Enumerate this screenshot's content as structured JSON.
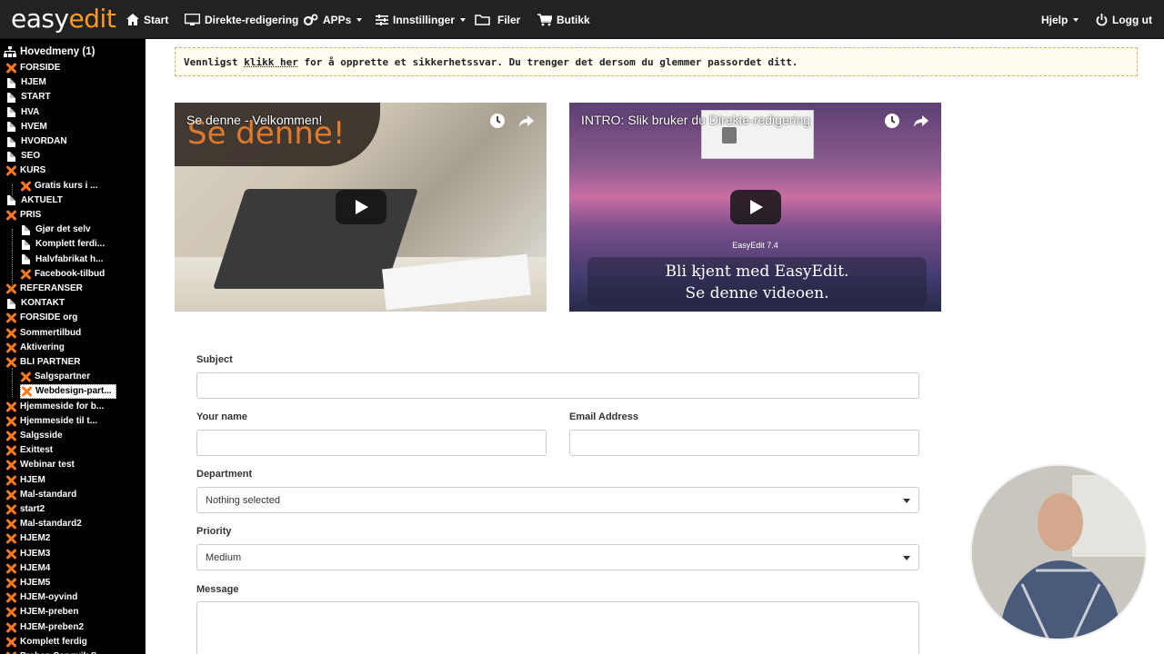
{
  "header": {
    "logo_part1": "easy",
    "logo_part2": "edit",
    "nav": [
      {
        "label": "Start",
        "icon": "home-icon"
      },
      {
        "label": "Direkte-redigering",
        "icon": "monitor-icon"
      },
      {
        "label": "APPs",
        "icon": "gears-icon",
        "dropdown": true
      },
      {
        "label": "Innstillinger",
        "icon": "sliders-icon",
        "dropdown": true
      },
      {
        "label": "Filer",
        "icon": "folder-icon"
      },
      {
        "label": "Butikk",
        "icon": "cart-icon"
      }
    ],
    "help_label": "Hjelp",
    "logout_label": "Logg ut"
  },
  "sidebar": {
    "root_label": "Hovedmeny (1)",
    "items": [
      {
        "label": "FORSIDE",
        "icon": "x",
        "level": 0
      },
      {
        "label": "HJEM",
        "icon": "page",
        "level": 0
      },
      {
        "label": "START",
        "icon": "page",
        "level": 0
      },
      {
        "label": "HVA",
        "icon": "page",
        "level": 0
      },
      {
        "label": "HVEM",
        "icon": "page",
        "level": 0
      },
      {
        "label": "HVORDAN",
        "icon": "page",
        "level": 0
      },
      {
        "label": "SEO",
        "icon": "page",
        "level": 0
      },
      {
        "label": "KURS",
        "icon": "x",
        "level": 0
      },
      {
        "label": "Gratis kurs i ...",
        "icon": "x",
        "level": 1
      },
      {
        "label": "AKTUELT",
        "icon": "page",
        "level": 0
      },
      {
        "label": "PRIS",
        "icon": "x",
        "level": 0
      },
      {
        "label": "Gjør det selv",
        "icon": "page",
        "level": 1
      },
      {
        "label": "Komplett ferdi...",
        "icon": "page",
        "level": 1
      },
      {
        "label": "Halvfabrikat h...",
        "icon": "page",
        "level": 1
      },
      {
        "label": "Facebook-tilbud",
        "icon": "x",
        "level": 1
      },
      {
        "label": "REFERANSER",
        "icon": "x",
        "level": 0
      },
      {
        "label": "KONTAKT",
        "icon": "page",
        "level": 0
      },
      {
        "label": "FORSIDE org",
        "icon": "x",
        "level": 0
      },
      {
        "label": "Sommertilbud",
        "icon": "x",
        "level": 0
      },
      {
        "label": "Aktivering",
        "icon": "x",
        "level": 0
      },
      {
        "label": "BLI PARTNER",
        "icon": "x",
        "level": 0
      },
      {
        "label": "Salgspartner",
        "icon": "x",
        "level": 1
      },
      {
        "label": "Webdesign-part...",
        "icon": "x",
        "level": 1,
        "selected": true
      },
      {
        "label": "Hjemmeside for b...",
        "icon": "x",
        "level": 0
      },
      {
        "label": "Hjemmeside til t...",
        "icon": "x",
        "level": 0
      },
      {
        "label": "Salgsside",
        "icon": "x",
        "level": 0
      },
      {
        "label": "Exittest",
        "icon": "x",
        "level": 0
      },
      {
        "label": "Webinar test",
        "icon": "x",
        "level": 0
      },
      {
        "label": "HJEM",
        "icon": "x",
        "level": 0
      },
      {
        "label": "Mal-standard",
        "icon": "x",
        "level": 0
      },
      {
        "label": "start2",
        "icon": "x",
        "level": 0
      },
      {
        "label": "Mal-standard2",
        "icon": "x",
        "level": 0
      },
      {
        "label": "HJEM2",
        "icon": "x",
        "level": 0
      },
      {
        "label": "HJEM3",
        "icon": "x",
        "level": 0
      },
      {
        "label": "HJEM4",
        "icon": "x",
        "level": 0
      },
      {
        "label": "HJEM5",
        "icon": "x",
        "level": 0
      },
      {
        "label": "HJEM-oyvind",
        "icon": "x",
        "level": 0
      },
      {
        "label": "HJEM-preben",
        "icon": "x",
        "level": 0
      },
      {
        "label": "HJEM-preben2",
        "icon": "x",
        "level": 0
      },
      {
        "label": "Komplett ferdig",
        "icon": "x",
        "level": 0
      },
      {
        "label": "Preben Sangvik S...",
        "icon": "x",
        "level": 0
      }
    ]
  },
  "notice": {
    "before": "Vennligst ",
    "link": "klikk her",
    "after": " for å opprette et sikkerhetssvar. Du trenger det dersom du glemmer passordet ditt."
  },
  "videos": [
    {
      "title": "Se denne - Velkommen!",
      "overlay": "Se denne!"
    },
    {
      "title": "INTRO: Slik bruker du Direkte-redigering",
      "version": "EasyEdit 7.4",
      "caption_line1": "Bli kjent med EasyEdit.",
      "caption_line2": "Se denne videoen."
    }
  ],
  "form": {
    "subject_label": "Subject",
    "subject_value": "",
    "name_label": "Your name",
    "name_value": "",
    "email_label": "Email Address",
    "email_value": "",
    "department_label": "Department",
    "department_value": "Nothing selected",
    "priority_label": "Priority",
    "priority_value": "Medium",
    "message_label": "Message",
    "message_value": ""
  },
  "colors": {
    "accent": "#ff7a1a",
    "topbar": "#222222",
    "sidebar": "#000000"
  }
}
